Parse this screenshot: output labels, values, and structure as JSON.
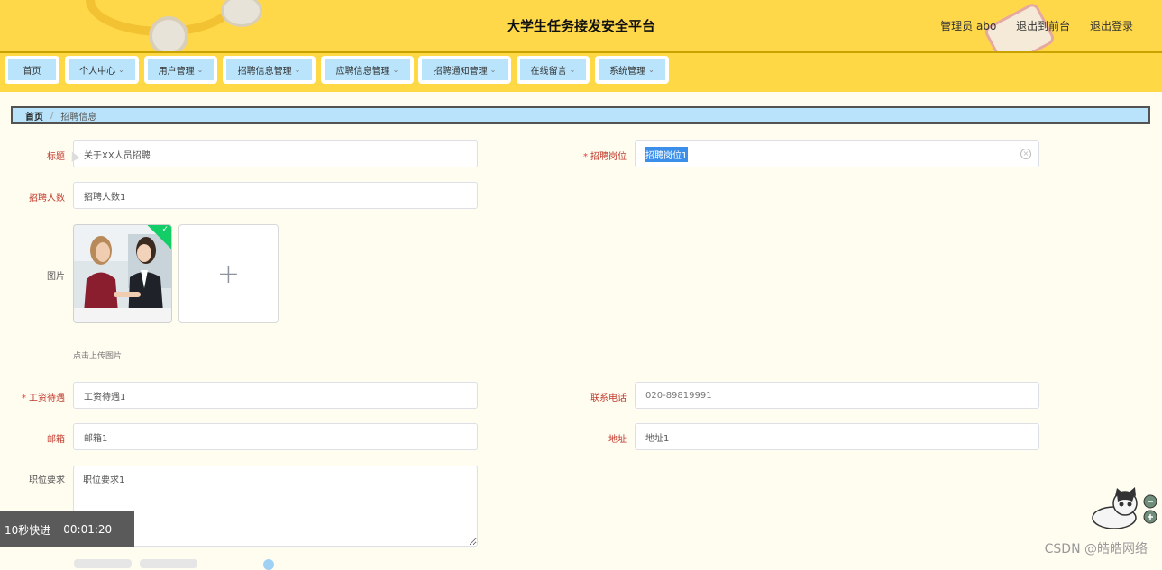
{
  "header": {
    "title": "大学生任务接发安全平台",
    "user_label": "管理员 abo",
    "front_link": "退出到前台",
    "logout_link": "退出登录"
  },
  "nav": [
    {
      "label": "首页",
      "dropdown": false
    },
    {
      "label": "个人中心",
      "dropdown": true
    },
    {
      "label": "用户管理",
      "dropdown": true
    },
    {
      "label": "招聘信息管理",
      "dropdown": true
    },
    {
      "label": "应聘信息管理",
      "dropdown": true
    },
    {
      "label": "招聘通知管理",
      "dropdown": true
    },
    {
      "label": "在线留言",
      "dropdown": true
    },
    {
      "label": "系统管理",
      "dropdown": true
    }
  ],
  "breadcrumb": {
    "home": "首页",
    "current": "招聘信息"
  },
  "form": {
    "title_label": "标题",
    "title_value": "关于XX人员招聘",
    "position_label": "招聘岗位",
    "position_value": "招聘岗位1",
    "count_label": "招聘人数",
    "count_value": "招聘人数1",
    "image_label": "图片",
    "upload_hint": "点击上传图片",
    "salary_label": "工资待遇",
    "salary_value": "工资待遇1",
    "phone_label": "联系电话",
    "phone_value": "020-89819991",
    "email_label": "邮箱",
    "email_value": "邮箱1",
    "address_label": "地址",
    "address_value": "地址1",
    "requirement_label": "职位要求",
    "requirement_value": "职位要求1"
  },
  "overlay": {
    "skip_label": "10秒快进",
    "time": "00:01:20",
    "watermark": "CSDN @皓皓网络"
  },
  "colors": {
    "header_bg": "#ffd84a",
    "nav_item_bg": "#b9e4fb",
    "label_red": "#c0392b",
    "page_bg": "#fffcf0"
  }
}
